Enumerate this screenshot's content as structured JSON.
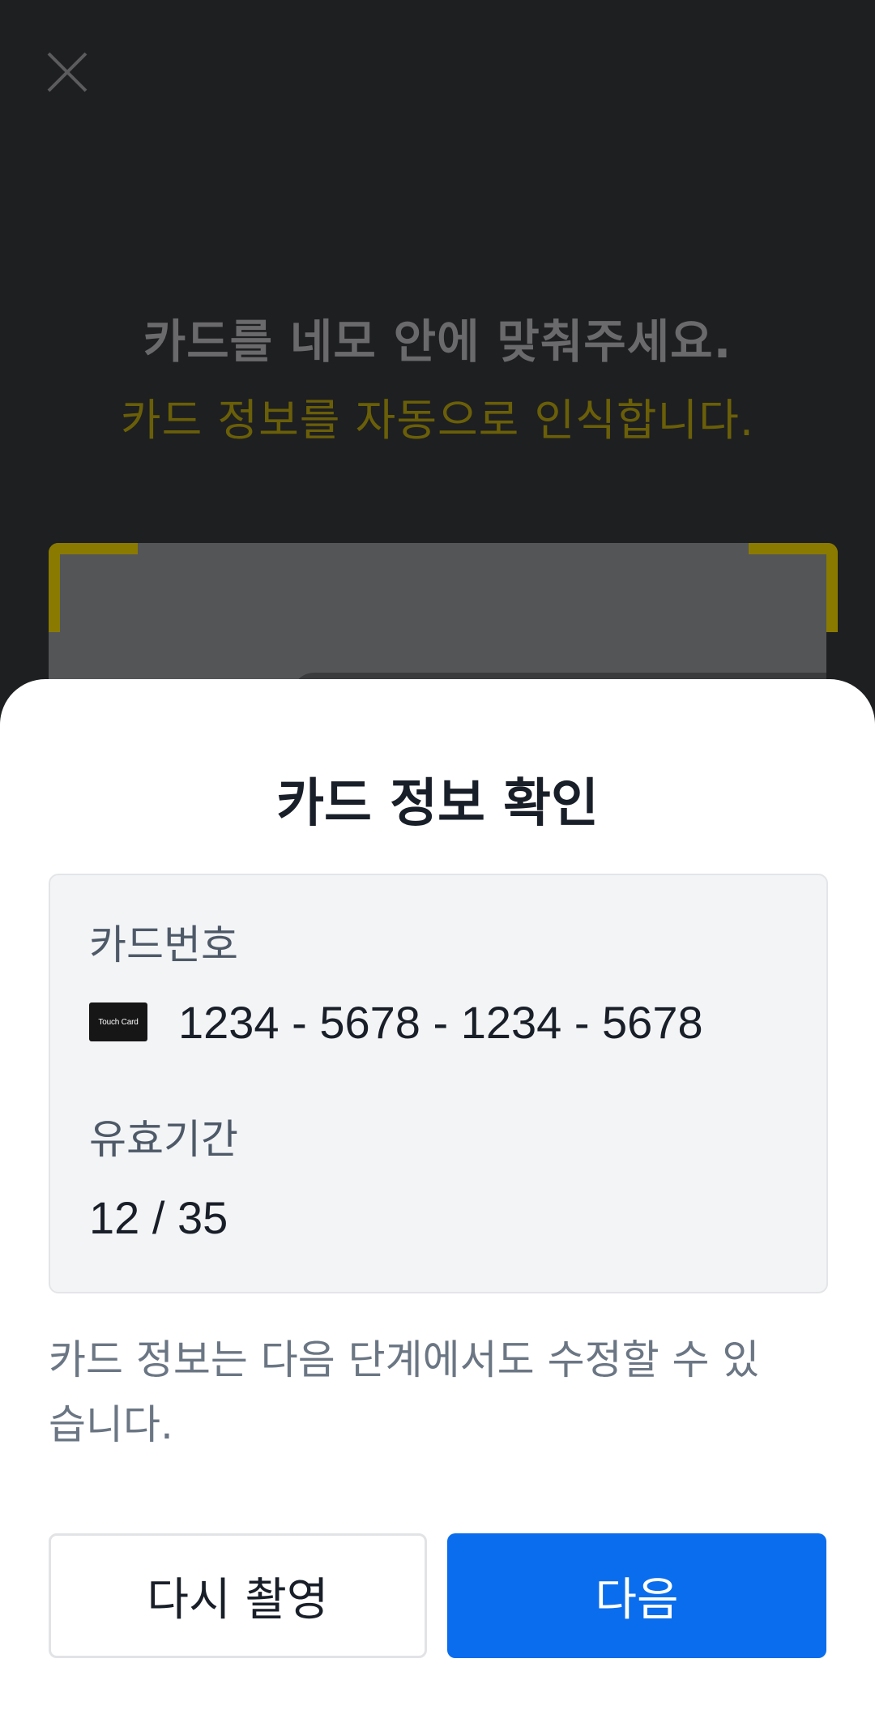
{
  "scanner": {
    "instruction_main": "카드를 네모 안에 맞춰주세요.",
    "instruction_sub": "카드 정보를 자동으로 인식합니다.",
    "close_icon": "close-icon",
    "accent_color": "#8a7a00"
  },
  "sheet": {
    "title": "카드 정보 확인",
    "card_number_label": "카드번호",
    "card_brand_text": "Touch Card",
    "card_number": "1234 - 5678 - 1234 - 5678",
    "expiry_label": "유효기간",
    "expiry": "12 / 35",
    "notice": "카드 정보는 다음 단계에서도 수정할 수 있습니다.",
    "retake_label": "다시 촬영",
    "next_label": "다음",
    "primary_color": "#0a6ded"
  }
}
